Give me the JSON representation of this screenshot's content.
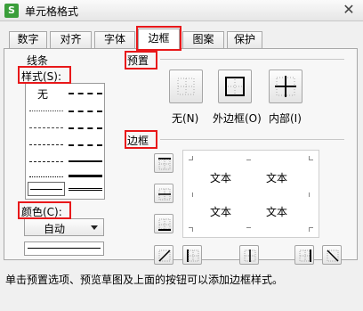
{
  "window": {
    "title": "单元格格式",
    "app_icon": "S",
    "close_glyph": "✕"
  },
  "tabs": [
    {
      "label": "数字"
    },
    {
      "label": "对齐"
    },
    {
      "label": "字体"
    },
    {
      "label": "边框",
      "active": true
    },
    {
      "label": "图案"
    },
    {
      "label": "保护"
    }
  ],
  "line": {
    "group_label": "线条",
    "style_label": "样式(S):",
    "style_none": "无",
    "color_label": "颜色(C):",
    "color_value": "自动"
  },
  "presets": {
    "label": "预置",
    "items": [
      {
        "label": "无(N)",
        "icon": "no-border-icon"
      },
      {
        "label": "外边框(O)",
        "icon": "outline-border-icon"
      },
      {
        "label": "内部(I)",
        "icon": "inside-border-icon"
      }
    ]
  },
  "border": {
    "label": "边框",
    "preview_text": [
      "文本",
      "文本",
      "文本",
      "文本"
    ]
  },
  "hint": "单击预置选项、预览草图及上面的按钮可以添加边框样式。",
  "colors": {
    "highlight": "#e8181a",
    "app_icon": "#3a9e3a"
  }
}
